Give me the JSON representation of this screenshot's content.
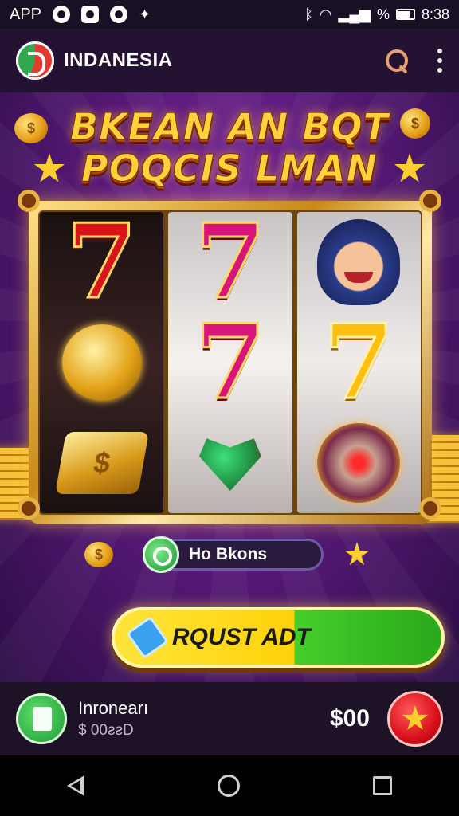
{
  "status_bar": {
    "app_label": "APP",
    "percent_sign": "%",
    "time": "8:38"
  },
  "app_bar": {
    "title": "INDANESIA"
  },
  "banner": {
    "line1": "BKEAN AN BQT",
    "line2": "POQCIS LMAN"
  },
  "reels": [
    [
      "red-seven",
      "gold-emblem",
      "gold-scroll"
    ],
    [
      "pink-seven",
      "pink-seven",
      "heart-guitar"
    ],
    [
      "character-portrait",
      "yellow-seven",
      "jewel-orb"
    ]
  ],
  "seven_glyph": "7",
  "scroll_glyph": "$",
  "coin_glyph": "$",
  "bonus": {
    "label": "Ho Bkons"
  },
  "spin": {
    "label": "RQUST ADT"
  },
  "user": {
    "name": "Inronearı",
    "balance": "$ 00ƨƨD"
  },
  "credit": "$00",
  "colors": {
    "headline": "#ffd23a",
    "spin_yellow": "#ffd20a",
    "spin_green": "#2aa81a",
    "badge_red": "#d8101a"
  }
}
